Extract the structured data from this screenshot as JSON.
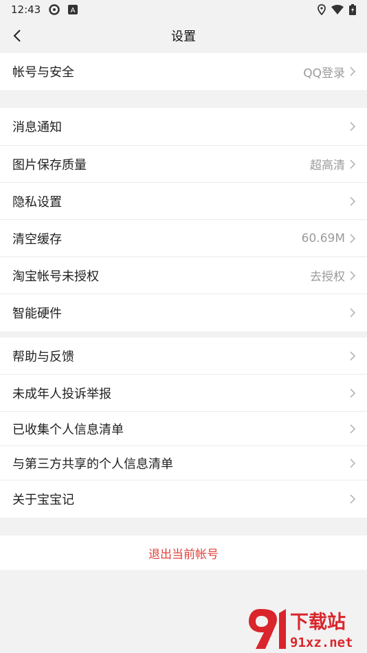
{
  "status_bar": {
    "time": "12:43"
  },
  "header": {
    "title": "设置"
  },
  "group1": [
    {
      "label": "帐号与安全",
      "value": "QQ登录"
    }
  ],
  "group2": [
    {
      "label": "消息通知",
      "value": ""
    },
    {
      "label": "图片保存质量",
      "value": "超高清"
    },
    {
      "label": "隐私设置",
      "value": ""
    },
    {
      "label": "清空缓存",
      "value": "60.69M"
    },
    {
      "label": "淘宝帐号未授权",
      "value": "去授权"
    },
    {
      "label": "智能硬件",
      "value": ""
    }
  ],
  "group3": [
    {
      "label": "帮助与反馈",
      "value": ""
    },
    {
      "label": "未成年人投诉举报",
      "value": ""
    },
    {
      "label": "已收集个人信息清单",
      "value": ""
    },
    {
      "label": "与第三方共享的个人信息清单",
      "value": ""
    },
    {
      "label": "关于宝宝记",
      "value": ""
    }
  ],
  "logout": {
    "label": "退出当前帐号"
  },
  "watermark": {
    "text1": "下载站",
    "text2": "91xz.net"
  },
  "colors": {
    "logout": "#e0413a",
    "watermark": "#d9252b"
  }
}
